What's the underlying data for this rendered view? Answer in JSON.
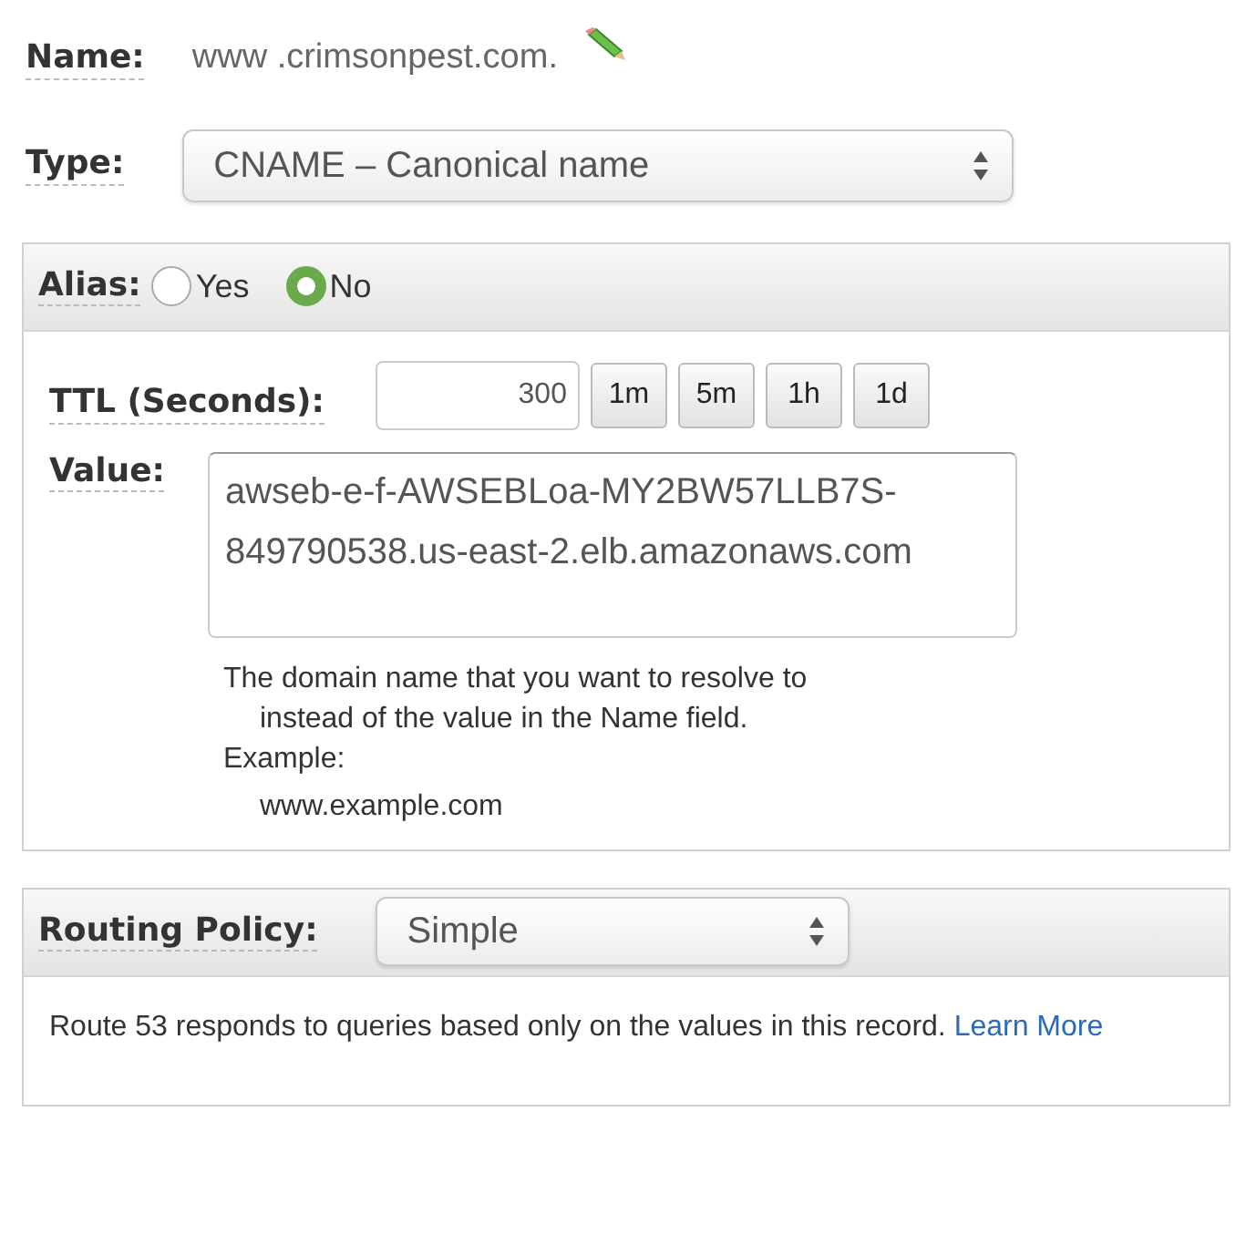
{
  "name_field": {
    "label": "Name:",
    "value": "www .crimsonpest.com."
  },
  "type_field": {
    "label": "Type:",
    "value": "CNAME – Canonical name"
  },
  "alias": {
    "label": "Alias:",
    "options": [
      {
        "label": "Yes",
        "selected": false
      },
      {
        "label": "No",
        "selected": true
      }
    ]
  },
  "ttl": {
    "label": "TTL (Seconds):",
    "value": "300",
    "presets": [
      "1m",
      "5m",
      "1h",
      "1d"
    ]
  },
  "value_field": {
    "label": "Value:",
    "value": "awseb-e-f-AWSEBLoa-MY2BW57LLB7S-849790538.us-east-2.elb.amazonaws.com",
    "help": "The domain name that you want to resolve to instead of the value in the Name field.",
    "example_label": "Example:",
    "example": "www.example.com"
  },
  "routing": {
    "label": "Routing Policy:",
    "value": "Simple",
    "description": "Route 53 responds to queries based only on the values in this record.",
    "link": "Learn More"
  }
}
